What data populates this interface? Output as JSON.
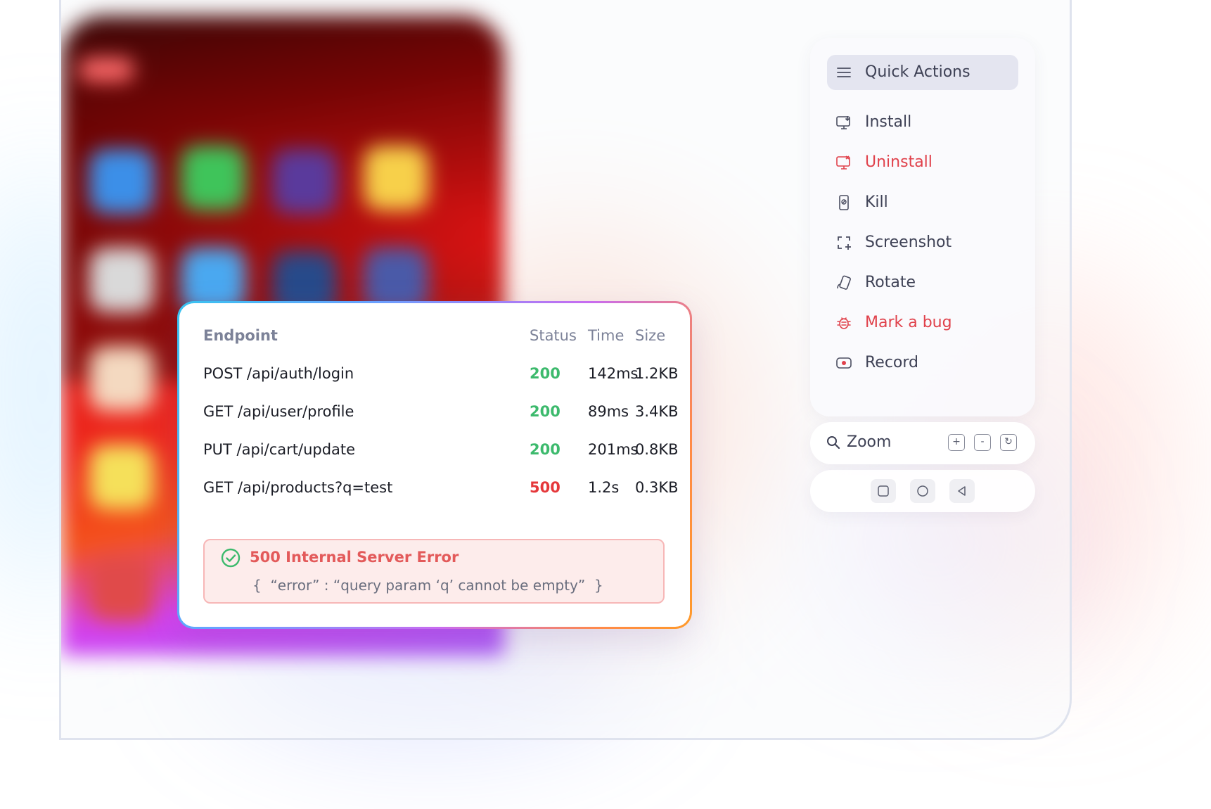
{
  "network": {
    "headers": {
      "endpoint": "Endpoint",
      "status": "Status",
      "time": "Time",
      "size": "Size"
    },
    "rows": [
      {
        "endpoint": "POST /api/auth/login",
        "status": "200",
        "time": "142ms",
        "size": "1.2KB"
      },
      {
        "endpoint": "GET /api/user/profile",
        "status": "200",
        "time": "89ms",
        "size": "3.4KB"
      },
      {
        "endpoint": "PUT /api/cart/update",
        "status": "200",
        "time": "201ms",
        "size": "0.8KB"
      },
      {
        "endpoint": "GET /api/products?q=test",
        "status": "500",
        "time": "1.2s",
        "size": "0.3KB"
      }
    ],
    "error": {
      "title": "500 Internal Server Error",
      "body": "{  “error” : “query param ‘q’ cannot be empty”  }"
    }
  },
  "quick_actions": {
    "title": "Quick Actions",
    "title_icon": "menu-icon",
    "items": [
      {
        "label": "Install",
        "icon": "install-icon"
      },
      {
        "label": "Uninstall",
        "icon": "uninstall-icon"
      },
      {
        "label": "Kill",
        "icon": "kill-icon"
      },
      {
        "label": "Screenshot",
        "icon": "screenshot-icon"
      },
      {
        "label": "Rotate",
        "icon": "rotate-icon"
      },
      {
        "label": "Mark a bug",
        "icon": "bug-icon"
      },
      {
        "label": "Record",
        "icon": "record-icon"
      }
    ]
  },
  "zoom": {
    "label": "Zoom",
    "icon": "search-icon",
    "buttons": {
      "in": "+",
      "out": "-",
      "reset": "↻"
    }
  },
  "nav": {
    "buttons": [
      "square-icon",
      "circle-icon",
      "back-triangle-icon"
    ]
  },
  "colors": {
    "success": "#3dba6d",
    "error": "#e5383b",
    "danger_action": "#e0414b",
    "panel_accent": "#e4e5f0",
    "error_bg": "#fdeceb"
  }
}
